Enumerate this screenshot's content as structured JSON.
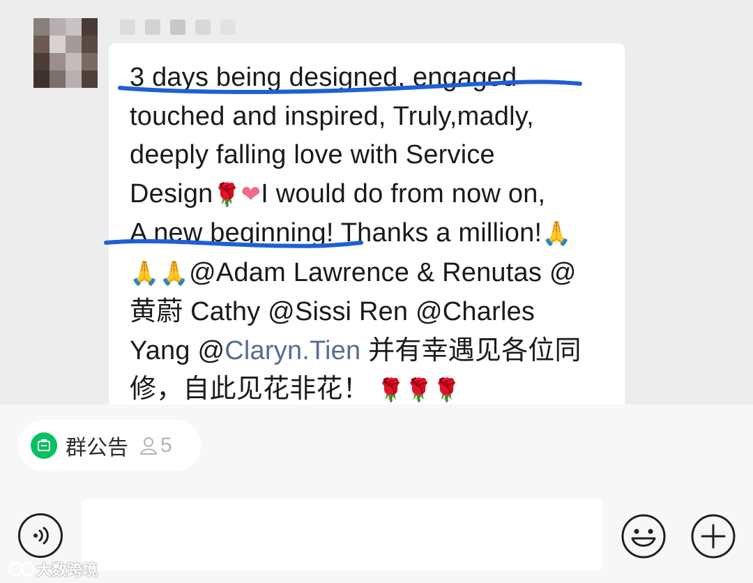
{
  "message": {
    "lines": [
      [
        {
          "t": "3 days being designed, engaged"
        }
      ],
      [
        {
          "t": "touched and inspired, Truly,madly,"
        }
      ],
      [
        {
          "t": "deeply falling love with Service"
        }
      ],
      [
        {
          "t": "Design"
        },
        {
          "e": "rose"
        },
        {
          "e": "heart"
        },
        {
          "t": "I would do from now on,"
        }
      ],
      [
        {
          "t": "A new beginning! Thanks a million!"
        },
        {
          "e": "pray"
        }
      ],
      [
        {
          "e": "pray"
        },
        {
          "e": "pray"
        },
        {
          "t": "@Adam Lawrence & Renutas @"
        }
      ],
      [
        {
          "t": "黄蔚 Cathy @Sissi Ren @Charles"
        }
      ],
      [
        {
          "t": "Yang @"
        },
        {
          "link": "Claryn.Tien"
        },
        {
          "t": "  并有幸遇见各位同"
        }
      ],
      [
        {
          "t": "修，自此见花非花！ "
        },
        {
          "e": "rose"
        },
        {
          "e": "rose"
        },
        {
          "e": "rose"
        }
      ]
    ],
    "emoji_glyphs": {
      "rose": "🌹",
      "heart": "❤",
      "pray": "🙏"
    },
    "underline_color": "#1f5fd6"
  },
  "announcement": {
    "label": "群公告",
    "member_count": "5",
    "icon": "announcement-icon",
    "accent": "#07c160"
  },
  "input_bar": {
    "voice_icon": "voice-icon",
    "emoji_icon": "emoji-face-icon",
    "plus_icon": "plus-icon",
    "placeholder": ""
  },
  "watermark": {
    "text": "大数跨境"
  }
}
